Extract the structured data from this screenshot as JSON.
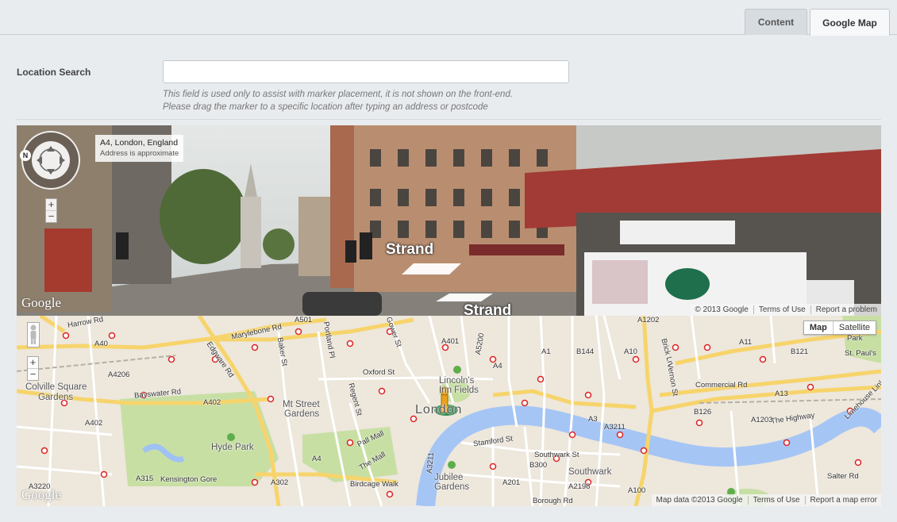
{
  "tabs": [
    {
      "label": "Content"
    },
    {
      "label": "Google Map"
    }
  ],
  "location_search": {
    "label": "Location Search",
    "value": "",
    "placeholder": "",
    "help_line1": "This field is used only to assist with marker placement, it is not shown on the front-end.",
    "help_line2": "Please drag the marker to a specific location after typing an address or postcode"
  },
  "street_view": {
    "address": "A4, London, England",
    "address_note": "Address is approximate",
    "compass_n": "N",
    "road_label_1": "Strand",
    "road_label_2": "Strand",
    "logo": "Google",
    "zoom_in": "+",
    "zoom_out": "−",
    "attribution": [
      "© 2013 Google",
      "Terms of Use",
      "Report a problem"
    ]
  },
  "map": {
    "map_type": {
      "map": "Map",
      "satellite": "Satellite"
    },
    "zoom_in": "+",
    "zoom_out": "−",
    "logo": "Google",
    "attribution": [
      "Map data ©2013 Google",
      "Terms of Use",
      "Report a map error"
    ],
    "labels": {
      "london": "London",
      "hyde_park": "Hyde Park",
      "colville": "Colville Square",
      "colville2": "Gardens",
      "mt_street": "Mt Street",
      "mt_street2": "Gardens",
      "lincolns": "Lincoln's",
      "lincolns2": "Inn Fields",
      "jubilee": "Jubilee",
      "jubilee2": "Gardens",
      "southwark": "Southwark",
      "salter": "Salter Rd",
      "st_pauls": "St. Paul's",
      "park": "Park",
      "marylebone": "Marylebone Rd",
      "harrow": "Harrow Rd",
      "edgware": "Edgware Rd",
      "bayswater": "Bayswater Rd",
      "kensington": "Kensington Gore",
      "oxford": "Oxford St",
      "pall_mall": "Pall Mall",
      "the_mall": "The Mall",
      "birdcage": "Birdcage Walk",
      "stamford": "Stamford St",
      "southwark_st": "Southwark St",
      "borough": "Borough Rd",
      "commercial": "Commercial Rd",
      "highway": "The Highway",
      "limehouse": "Limehouse Link",
      "a40": "A40",
      "a501": "A501",
      "a4206": "A4206",
      "a402": "A402",
      "a402b": "A402",
      "a4": "A4",
      "a4b": "A4",
      "a315": "A315",
      "a3220": "A3220",
      "a302": "A302",
      "a401": "A401",
      "a5200": "A5200",
      "a1": "A1",
      "a1202": "A1202",
      "a11": "A11",
      "a13": "A13",
      "a1203": "A1203",
      "a3211": "A3211",
      "a3211b": "A3211",
      "b300": "B300",
      "a2198": "A2198",
      "a201": "A201",
      "a3": "A3",
      "a100": "A100",
      "b126": "B126",
      "b121": "B121",
      "b144": "B144",
      "a10": "A10",
      "baker": "Baker St",
      "portland": "Portland Pl",
      "gower": "Gower St",
      "regent": "Regent St",
      "brick": "Brick Ln",
      "vernon": "Vernon St"
    }
  }
}
